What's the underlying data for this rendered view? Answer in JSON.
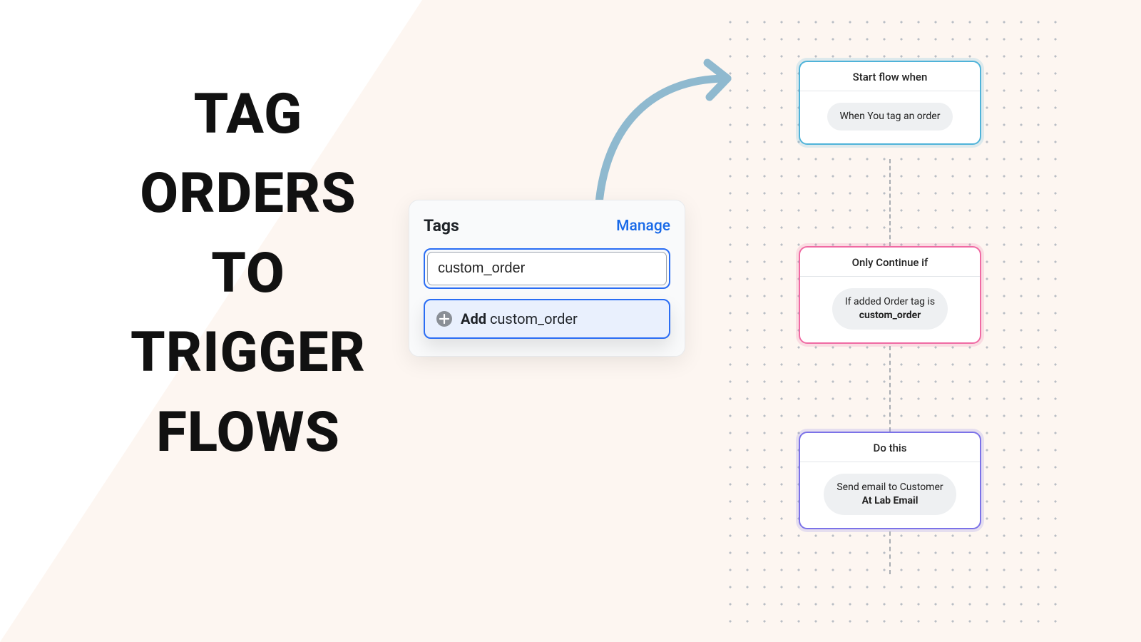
{
  "headline": {
    "l1": "TAG",
    "l2": "ORDERS",
    "l3": "TO",
    "l4": "TRIGGER",
    "l5": "FLOWS"
  },
  "tags_card": {
    "title": "Tags",
    "manage": "Manage",
    "input_value": "custom_order",
    "add_prefix": "Add",
    "add_value": "custom_order"
  },
  "flow": {
    "start": {
      "header": "Start flow when",
      "pill": "When You tag an order"
    },
    "condition": {
      "header": "Only Continue if",
      "pill_line1": "If added Order tag is",
      "pill_bold": "custom_order"
    },
    "action": {
      "header": "Do this",
      "pill_line1": "Send email to Customer",
      "pill_bold": "At Lab Email"
    }
  }
}
